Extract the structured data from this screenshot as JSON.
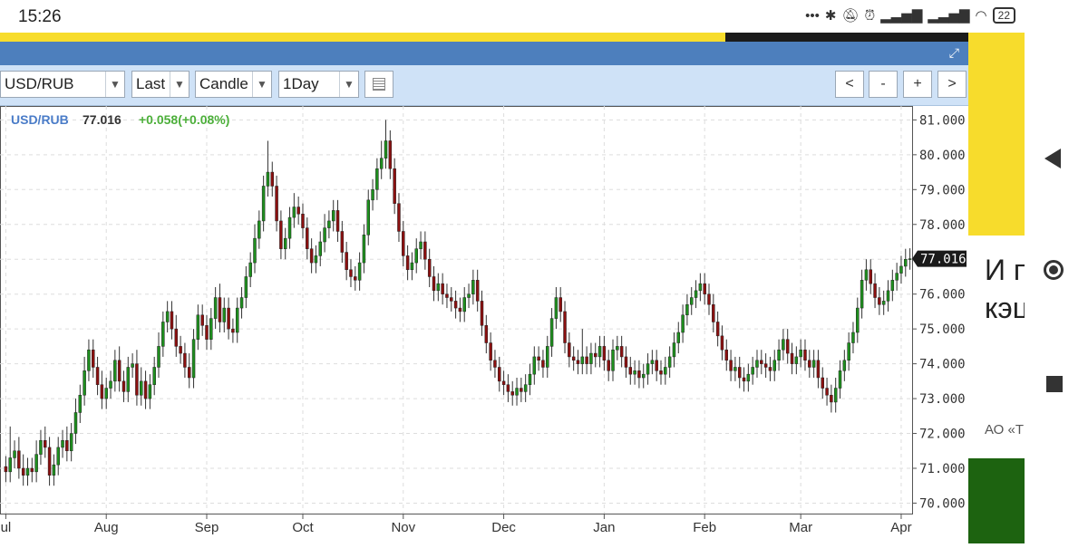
{
  "status_bar": {
    "time": "15:26",
    "battery": "22",
    "icons": [
      "more-dots-icon",
      "bluetooth-icon",
      "mute-icon",
      "alarm-icon",
      "signal-icon",
      "signal-icon",
      "wifi-icon",
      "battery-icon"
    ]
  },
  "toolbar": {
    "symbol": "USD/RUB",
    "price_type": "Last",
    "chart_type": "Candle",
    "interval": "1Day",
    "nav_buttons": [
      "<",
      "-",
      "+",
      ">"
    ]
  },
  "ad": {
    "line1": "И п",
    "line2": "кэц",
    "small": "АО «Т"
  },
  "colors": {
    "up": "#1e8f1e",
    "down": "#8b1010",
    "header": "#4d7fbd",
    "toolbar": "#cfe2f7",
    "symbol": "#4a7cc8",
    "change": "#4caf3a"
  },
  "chart_data": {
    "type": "candlestick",
    "title": {
      "symbol": "USD/RUB",
      "price": "77.016",
      "change": "+0.058(+0.08%)"
    },
    "last_price_label": "77.016",
    "ylim": [
      69.7,
      81.4
    ],
    "y_ticks": [
      "81.000",
      "80.000",
      "79.000",
      "78.000",
      "77.000",
      "76.000",
      "75.000",
      "74.000",
      "73.000",
      "72.000",
      "71.000",
      "70.000"
    ],
    "x_ticks": [
      {
        "label": "ul",
        "index": 0
      },
      {
        "label": "Aug",
        "index": 23
      },
      {
        "label": "Sep",
        "index": 46
      },
      {
        "label": "Oct",
        "index": 68
      },
      {
        "label": "Nov",
        "index": 91
      },
      {
        "label": "Dec",
        "index": 114
      },
      {
        "label": "Jan",
        "index": 137
      },
      {
        "label": "Feb",
        "index": 160
      },
      {
        "label": "Mar",
        "index": 182
      },
      {
        "label": "Apr",
        "index": 205
      }
    ],
    "grid": true,
    "close": [
      70.9,
      71.3,
      71.5,
      71.0,
      70.8,
      71.0,
      70.9,
      71.4,
      71.8,
      71.6,
      70.8,
      71.1,
      71.6,
      71.8,
      71.5,
      72.0,
      72.6,
      73.1,
      73.8,
      74.4,
      73.9,
      73.4,
      73.0,
      73.3,
      73.5,
      74.1,
      73.5,
      73.2,
      73.9,
      74.0,
      73.1,
      73.5,
      73.0,
      73.4,
      73.9,
      74.5,
      75.2,
      75.5,
      75.0,
      74.5,
      74.3,
      73.9,
      73.6,
      74.7,
      75.4,
      75.1,
      74.7,
      75.3,
      75.9,
      75.2,
      75.6,
      75.0,
      74.9,
      75.6,
      75.9,
      76.5,
      76.9,
      77.6,
      78.1,
      79.1,
      79.5,
      79.1,
      78.1,
      77.3,
      77.6,
      78.2,
      78.5,
      78.3,
      77.9,
      77.3,
      76.9,
      77.1,
      77.5,
      77.9,
      78.1,
      78.4,
      77.8,
      77.2,
      76.7,
      76.5,
      76.4,
      76.9,
      77.7,
      78.7,
      79.0,
      79.6,
      79.9,
      80.4,
      79.6,
      78.6,
      77.8,
      77.1,
      76.7,
      76.9,
      77.3,
      77.5,
      77.0,
      76.5,
      76.1,
      76.3,
      76.0,
      75.9,
      75.8,
      75.6,
      75.5,
      75.9,
      76.0,
      76.4,
      75.8,
      75.1,
      74.6,
      74.1,
      73.9,
      73.5,
      73.4,
      73.2,
      73.1,
      73.3,
      73.2,
      73.4,
      73.7,
      74.2,
      74.1,
      73.9,
      74.5,
      75.3,
      75.9,
      75.5,
      74.6,
      74.2,
      74.1,
      74.0,
      74.2,
      74.0,
      74.3,
      74.2,
      74.5,
      74.1,
      73.8,
      74.4,
      74.5,
      74.2,
      73.9,
      73.7,
      73.8,
      73.6,
      73.7,
      74.0,
      74.1,
      73.8,
      73.7,
      73.9,
      74.2,
      74.6,
      74.9,
      75.4,
      75.7,
      75.9,
      76.1,
      76.3,
      76.0,
      75.7,
      75.2,
      74.8,
      74.4,
      74.1,
      73.8,
      73.9,
      73.6,
      73.5,
      73.7,
      73.9,
      74.1,
      74.0,
      73.9,
      73.8,
      74.1,
      74.4,
      74.7,
      74.3,
      74.0,
      74.2,
      74.4,
      74.1,
      73.9,
      74.1,
      73.6,
      73.3,
      73.1,
      72.9,
      73.3,
      73.8,
      74.1,
      74.6,
      74.9,
      75.6,
      76.4,
      76.7,
      76.3,
      75.9,
      75.7,
      75.8,
      76.1,
      76.4,
      76.6,
      76.8,
      77.0,
      77.016
    ],
    "wick_hi": [
      0.3,
      0.9,
      0.3,
      0.4,
      0.4,
      0.3,
      0.3,
      0.4,
      0.3,
      0.4,
      0.3,
      0.3,
      0.3,
      0.3,
      0.4,
      0.3,
      0.4,
      0.3,
      0.4,
      0.3,
      0.3,
      0.3,
      0.4,
      0.3,
      0.3,
      0.3,
      0.4,
      0.3,
      0.3,
      0.3,
      0.4,
      0.4,
      0.3,
      0.3,
      0.3,
      0.4,
      0.3,
      0.3,
      0.3,
      0.4,
      0.3,
      0.3,
      0.4,
      0.3,
      0.3,
      0.3,
      0.3,
      0.3,
      0.3,
      0.4,
      0.3,
      0.3,
      0.3,
      0.3,
      0.3,
      0.3,
      0.3,
      0.4,
      0.3,
      0.3,
      0.9,
      0.3,
      0.3,
      0.3,
      0.3,
      0.3,
      0.4,
      0.3,
      0.3,
      0.3,
      0.3,
      0.3,
      0.3,
      0.4,
      0.3,
      0.3,
      0.3,
      0.3,
      0.3,
      0.3,
      0.3,
      0.3,
      0.3,
      0.3,
      0.3,
      0.3,
      0.5,
      0.6,
      0.3,
      0.3,
      0.3,
      0.3,
      0.3,
      0.3,
      0.3,
      0.3,
      0.3,
      0.3,
      0.3,
      0.3,
      0.3,
      0.3,
      0.3,
      0.3,
      0.3,
      0.3,
      0.3,
      0.3,
      0.3,
      0.3,
      0.3,
      0.3,
      0.3,
      0.3,
      0.3,
      0.3,
      0.3,
      0.3,
      0.3,
      0.3,
      0.3,
      0.3,
      0.3,
      0.3,
      0.3,
      0.3,
      0.3,
      0.3,
      0.3,
      0.3,
      0.3,
      0.3,
      0.8,
      0.3,
      0.3,
      0.3,
      0.3,
      0.3,
      0.3,
      0.3,
      0.3,
      0.3,
      0.3,
      0.3,
      0.3,
      0.3,
      0.3,
      0.3,
      0.3,
      0.3,
      0.3,
      0.3,
      0.3,
      0.3,
      0.3,
      0.3,
      0.3,
      0.3,
      0.3,
      0.3,
      0.3,
      0.3,
      0.3,
      0.3,
      0.3,
      0.3,
      0.3,
      0.3,
      0.3,
      0.3,
      0.3,
      0.3,
      0.3,
      0.3,
      0.3,
      0.3,
      0.3,
      0.3,
      0.3,
      0.3,
      0.3,
      0.3,
      0.3,
      0.3,
      0.3,
      0.3,
      0.3,
      0.3,
      0.3,
      0.3,
      0.3,
      0.3,
      0.3,
      0.3,
      0.3,
      0.3,
      0.3,
      0.3,
      0.3,
      0.3,
      0.3,
      0.3,
      0.3,
      0.3,
      0.3,
      0.3,
      0.3,
      0.3,
      1.0,
      0.3
    ],
    "wick_lo": [
      0.3,
      0.3,
      0.3,
      0.3,
      0.3,
      0.3,
      0.3,
      0.3,
      0.3,
      0.3,
      0.3,
      0.3,
      0.3,
      0.3,
      0.3,
      0.3,
      0.3,
      0.3,
      0.3,
      0.3,
      0.3,
      0.3,
      0.3,
      0.3,
      0.3,
      0.3,
      0.3,
      0.3,
      0.3,
      0.3,
      0.3,
      0.3,
      0.3,
      0.3,
      0.3,
      0.3,
      0.3,
      0.3,
      0.3,
      0.3,
      0.3,
      0.3,
      0.3,
      0.3,
      0.3,
      0.3,
      0.3,
      0.3,
      0.3,
      0.3,
      0.3,
      0.3,
      0.3,
      0.3,
      0.3,
      0.3,
      0.3,
      0.3,
      0.3,
      0.3,
      0.3,
      0.3,
      0.3,
      0.3,
      0.3,
      0.3,
      0.3,
      0.3,
      0.3,
      0.3,
      0.3,
      0.3,
      0.3,
      0.3,
      0.3,
      0.3,
      0.3,
      0.3,
      0.3,
      0.3,
      0.3,
      0.3,
      0.3,
      0.3,
      0.3,
      0.3,
      0.3,
      0.3,
      0.3,
      0.3,
      0.3,
      0.3,
      0.3,
      0.3,
      0.3,
      0.3,
      0.3,
      0.3,
      0.3,
      0.3,
      0.3,
      0.3,
      0.3,
      0.3,
      0.3,
      0.3,
      0.3,
      0.3,
      0.3,
      0.3,
      0.3,
      0.3,
      0.3,
      0.3,
      0.3,
      0.3,
      0.3,
      0.3,
      0.3,
      0.3,
      0.3,
      0.3,
      0.3,
      0.3,
      0.3,
      0.3,
      0.3,
      0.3,
      0.3,
      0.3,
      0.3,
      0.3,
      0.3,
      0.3,
      0.3,
      0.3,
      0.3,
      0.3,
      0.3,
      0.3,
      0.3,
      0.3,
      0.3,
      0.3,
      0.3,
      0.3,
      0.3,
      0.3,
      0.3,
      0.3,
      0.3,
      0.3,
      0.3,
      0.3,
      0.3,
      0.3,
      0.3,
      0.3,
      0.3,
      0.3,
      0.3,
      0.3,
      0.3,
      0.3,
      0.3,
      0.3,
      0.3,
      0.3,
      0.3,
      0.3,
      0.3,
      0.3,
      0.3,
      0.3,
      0.3,
      0.3,
      0.3,
      0.3,
      0.3,
      0.3,
      0.3,
      0.3,
      0.3,
      0.3,
      0.3,
      0.3,
      0.3,
      0.3,
      0.3,
      0.3,
      0.3,
      0.3,
      0.3,
      0.3,
      0.3,
      0.3,
      0.3,
      0.3,
      0.3,
      0.3,
      0.3,
      0.3,
      0.3,
      0.3,
      0.3,
      0.3,
      0.3,
      0.3,
      0.3,
      0.3,
      0.3,
      0.3,
      0.3,
      0.3
    ]
  }
}
